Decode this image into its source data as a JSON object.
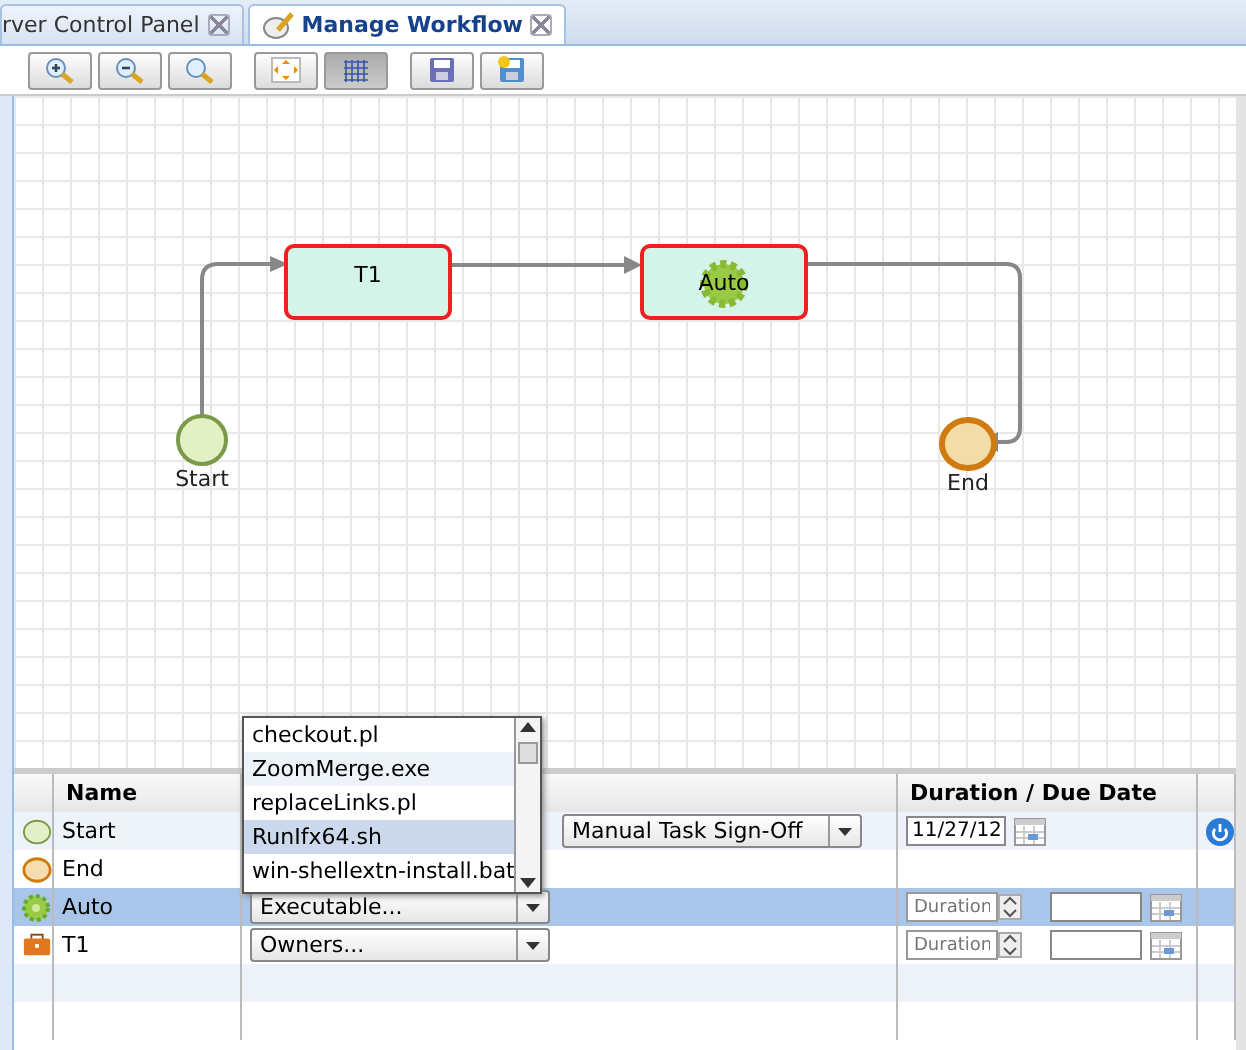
{
  "tabs": [
    {
      "label": "rver Control Panel",
      "selected": false,
      "icon": false
    },
    {
      "label": "Manage Workflow",
      "selected": true,
      "icon": true
    }
  ],
  "toolbar": [
    {
      "buttons": [
        {
          "kind": "zoom-in",
          "pressed": false
        },
        {
          "kind": "zoom-out",
          "pressed": false
        },
        {
          "kind": "search",
          "pressed": false
        }
      ]
    },
    {
      "buttons": [
        {
          "kind": "fit",
          "pressed": false
        },
        {
          "kind": "grid",
          "pressed": true
        }
      ]
    },
    {
      "buttons": [
        {
          "kind": "save",
          "pressed": false
        },
        {
          "kind": "save-as",
          "pressed": false
        }
      ]
    }
  ],
  "workflow": {
    "nodes": [
      {
        "kind": "start",
        "label": "Start"
      },
      {
        "kind": "task",
        "label": "T1"
      },
      {
        "kind": "auto",
        "label": "Auto"
      },
      {
        "kind": "end",
        "label": "End"
      }
    ]
  },
  "table": {
    "columns": [
      "Name",
      "Duration / Due Date"
    ],
    "rows": [
      {
        "kind": "start",
        "name": "Start",
        "selected": false,
        "control": "Manual Task Sign-Off",
        "due": {
          "kind": "date",
          "value": "11/27/12"
        },
        "action": true
      },
      {
        "kind": "end",
        "name": "End",
        "selected": false,
        "action": false
      },
      {
        "kind": "auto",
        "name": "Auto",
        "selected": true,
        "control": "Executable...",
        "due": {
          "kind": "duration",
          "placeholder": "Duration"
        },
        "action": false
      },
      {
        "kind": "task",
        "name": "T1",
        "selected": false,
        "control": "Owners...",
        "due": {
          "kind": "duration",
          "placeholder": "Duration"
        },
        "action": false
      }
    ]
  },
  "dropdown": {
    "items": [
      {
        "label": "checkout.pl",
        "selected": false
      },
      {
        "label": "ZoomMerge.exe",
        "selected": false
      },
      {
        "label": "replaceLinks.pl",
        "selected": false
      },
      {
        "label": "RunIfx64.sh",
        "selected": true
      },
      {
        "label": "win-shellextn-install.bat",
        "selected": false
      }
    ]
  }
}
